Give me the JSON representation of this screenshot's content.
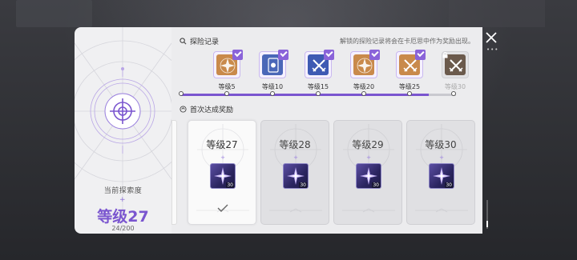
{
  "left_panel": {
    "label": "当前探索度",
    "plus": "+",
    "level": "等级27",
    "progress": "24/200"
  },
  "records": {
    "title": "探险记录",
    "hint": "解锁的探险记录将会在卡厄思中作为奖励出现。",
    "badges": [
      {
        "label": "等级5",
        "unlocked": true,
        "color": "#c98a4b",
        "icon": "star-compass-icon"
      },
      {
        "label": "等级10",
        "unlocked": true,
        "color": "#4a67b8",
        "icon": "card-icon"
      },
      {
        "label": "等级15",
        "unlocked": true,
        "color": "#3e5ab3",
        "icon": "crossed-swords-icon"
      },
      {
        "label": "等级20",
        "unlocked": true,
        "color": "#c98a4b",
        "icon": "star-compass-icon"
      },
      {
        "label": "等级25",
        "unlocked": true,
        "color": "#c98a4b",
        "icon": "crossed-swords-icon"
      },
      {
        "label": "等级30",
        "unlocked": false,
        "color": "#6b5a4c",
        "icon": "crossed-swords-icon"
      }
    ],
    "progress_fraction": 0.9
  },
  "rewards": {
    "title": "首次达成奖励",
    "cards": [
      {
        "level": "等级27",
        "qty": "30",
        "claimed": true
      },
      {
        "level": "等级28",
        "qty": "30",
        "claimed": false
      },
      {
        "level": "等级29",
        "qty": "30",
        "claimed": false
      },
      {
        "level": "等级30",
        "qty": "30",
        "claimed": false
      }
    ]
  },
  "colors": {
    "accent": "#7a55cf",
    "panel": "#ececee"
  }
}
